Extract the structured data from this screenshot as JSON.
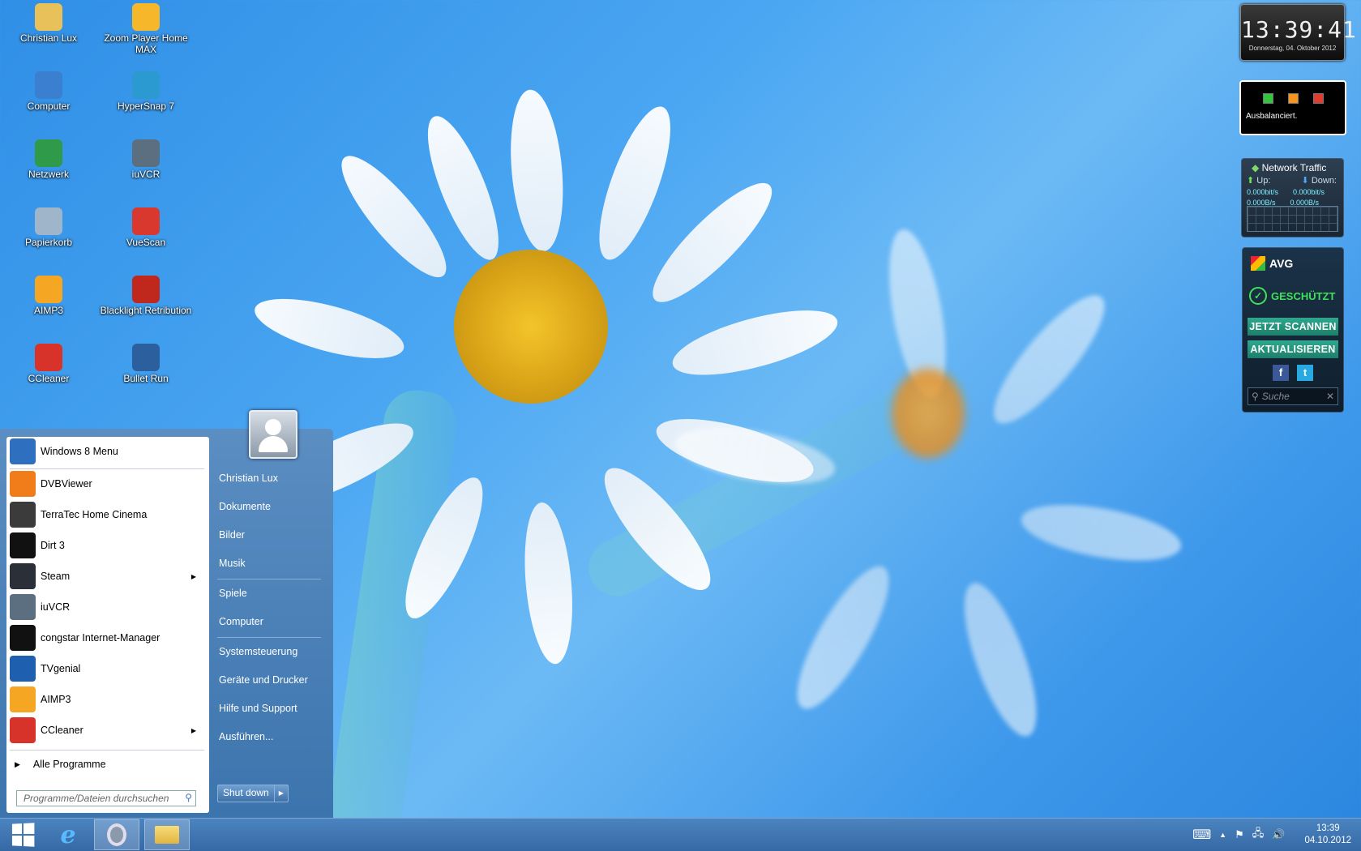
{
  "desktop": {
    "icons": [
      {
        "label": "Christian Lux",
        "icon": "user-folder-icon",
        "color": "#e8c15a"
      },
      {
        "label": "Zoom Player Home MAX",
        "icon": "zoom-player-icon",
        "color": "#f6b82a"
      },
      {
        "label": "Computer",
        "icon": "computer-icon",
        "color": "#3a7fd0"
      },
      {
        "label": "HyperSnap 7",
        "icon": "hypersnap-icon",
        "color": "#2a9ad0"
      },
      {
        "label": "Netzwerk",
        "icon": "network-icon",
        "color": "#2f9a4a"
      },
      {
        "label": "iuVCR",
        "icon": "iuvcr-icon",
        "color": "#5b6f80"
      },
      {
        "label": "Papierkorb",
        "icon": "recycle-bin-icon",
        "color": "#9fb5c9"
      },
      {
        "label": "VueScan",
        "icon": "vuescan-icon",
        "color": "#d9382e"
      },
      {
        "label": "AIMP3",
        "icon": "aimp-icon",
        "color": "#f5a623"
      },
      {
        "label": "Blacklight Retribution",
        "icon": "blacklight-icon",
        "color": "#c0281e"
      },
      {
        "label": "CCleaner",
        "icon": "ccleaner-icon",
        "color": "#d8332b"
      },
      {
        "label": "Bullet Run",
        "icon": "bullet-run-icon",
        "color": "#2b5f9e"
      }
    ]
  },
  "gadgets": {
    "clock": {
      "time": "13:39:41",
      "date": "Donnerstag, 04. Oktober 2012"
    },
    "power": {
      "status": "Ausbalanciert.",
      "flag_colors": [
        "#36c43e",
        "#f7941d",
        "#e23b2f"
      ]
    },
    "network": {
      "title": "Network Traffic",
      "up_label": "Up:",
      "down_label": "Down:",
      "up_bits": "0.000bit/s",
      "down_bits": "0.000bit/s",
      "up_bytes": "0.000B/s",
      "down_bytes": "0.000B/s"
    },
    "avg": {
      "brand": "AVG",
      "status": "GESCHÜTZT",
      "scan_button": "JETZT SCANNEN",
      "update_button": "AKTUALISIEREN",
      "search_placeholder": "Suche"
    }
  },
  "start_menu": {
    "pinned": {
      "label": "Windows 8 Menu",
      "icon": "windows8-menu-icon",
      "color": "#2f6fc0"
    },
    "programs": [
      {
        "label": "DVBViewer",
        "icon": "dvbviewer-icon",
        "color": "#f07d1a",
        "submenu": false
      },
      {
        "label": "TerraTec Home Cinema",
        "icon": "terratec-icon",
        "color": "#3b3b3b",
        "submenu": false
      },
      {
        "label": "Dirt 3",
        "icon": "dirt3-icon",
        "color": "#111111",
        "submenu": false
      },
      {
        "label": "Steam",
        "icon": "steam-icon",
        "color": "#2a2f38",
        "submenu": true
      },
      {
        "label": "iuVCR",
        "icon": "iuvcr-icon",
        "color": "#5b6f80",
        "submenu": false
      },
      {
        "label": "congstar Internet-Manager",
        "icon": "congstar-icon",
        "color": "#111111",
        "submenu": false
      },
      {
        "label": "TVgenial",
        "icon": "tvgenial-icon",
        "color": "#1e5fb0",
        "submenu": false
      },
      {
        "label": "AIMP3",
        "icon": "aimp-icon",
        "color": "#f5a623",
        "submenu": false
      },
      {
        "label": "CCleaner",
        "icon": "ccleaner-icon",
        "color": "#d8332b",
        "submenu": true
      }
    ],
    "all_programs": "Alle Programme",
    "search_placeholder": "Programme/Dateien durchsuchen",
    "right_items": [
      "Christian Lux",
      "Dokumente",
      "Bilder",
      "Musik",
      "Spiele",
      "Computer",
      "Systemsteuerung",
      "Geräte und Drucker",
      "Hilfe und Support",
      "Ausführen..."
    ],
    "shutdown_label": "Shut down"
  },
  "taskbar": {
    "apps": [
      {
        "name": "internet-explorer",
        "icon": "internet-explorer-icon"
      },
      {
        "name": "opera",
        "icon": "opera-icon"
      },
      {
        "name": "file-explorer",
        "icon": "folder-icon"
      }
    ],
    "clock_time": "13:39",
    "clock_date": "04.10.2012"
  }
}
